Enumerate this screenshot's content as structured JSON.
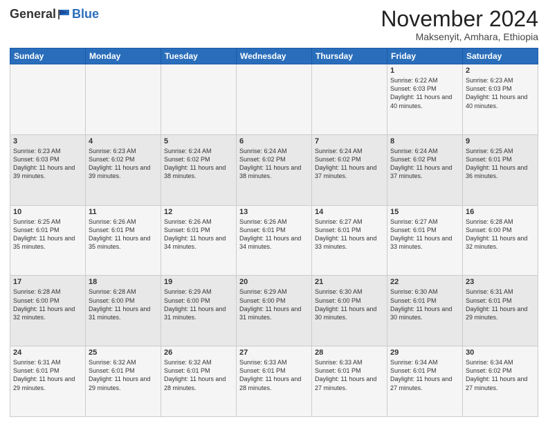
{
  "logo": {
    "general": "General",
    "blue": "Blue"
  },
  "header": {
    "month": "November 2024",
    "location": "Maksenyit, Amhara, Ethiopia"
  },
  "weekdays": [
    "Sunday",
    "Monday",
    "Tuesday",
    "Wednesday",
    "Thursday",
    "Friday",
    "Saturday"
  ],
  "weeks": [
    [
      {
        "day": "",
        "info": ""
      },
      {
        "day": "",
        "info": ""
      },
      {
        "day": "",
        "info": ""
      },
      {
        "day": "",
        "info": ""
      },
      {
        "day": "",
        "info": ""
      },
      {
        "day": "1",
        "info": "Sunrise: 6:22 AM\nSunset: 6:03 PM\nDaylight: 11 hours and 40 minutes."
      },
      {
        "day": "2",
        "info": "Sunrise: 6:23 AM\nSunset: 6:03 PM\nDaylight: 11 hours and 40 minutes."
      }
    ],
    [
      {
        "day": "3",
        "info": "Sunrise: 6:23 AM\nSunset: 6:03 PM\nDaylight: 11 hours and 39 minutes."
      },
      {
        "day": "4",
        "info": "Sunrise: 6:23 AM\nSunset: 6:02 PM\nDaylight: 11 hours and 39 minutes."
      },
      {
        "day": "5",
        "info": "Sunrise: 6:24 AM\nSunset: 6:02 PM\nDaylight: 11 hours and 38 minutes."
      },
      {
        "day": "6",
        "info": "Sunrise: 6:24 AM\nSunset: 6:02 PM\nDaylight: 11 hours and 38 minutes."
      },
      {
        "day": "7",
        "info": "Sunrise: 6:24 AM\nSunset: 6:02 PM\nDaylight: 11 hours and 37 minutes."
      },
      {
        "day": "8",
        "info": "Sunrise: 6:24 AM\nSunset: 6:02 PM\nDaylight: 11 hours and 37 minutes."
      },
      {
        "day": "9",
        "info": "Sunrise: 6:25 AM\nSunset: 6:01 PM\nDaylight: 11 hours and 36 minutes."
      }
    ],
    [
      {
        "day": "10",
        "info": "Sunrise: 6:25 AM\nSunset: 6:01 PM\nDaylight: 11 hours and 35 minutes."
      },
      {
        "day": "11",
        "info": "Sunrise: 6:26 AM\nSunset: 6:01 PM\nDaylight: 11 hours and 35 minutes."
      },
      {
        "day": "12",
        "info": "Sunrise: 6:26 AM\nSunset: 6:01 PM\nDaylight: 11 hours and 34 minutes."
      },
      {
        "day": "13",
        "info": "Sunrise: 6:26 AM\nSunset: 6:01 PM\nDaylight: 11 hours and 34 minutes."
      },
      {
        "day": "14",
        "info": "Sunrise: 6:27 AM\nSunset: 6:01 PM\nDaylight: 11 hours and 33 minutes."
      },
      {
        "day": "15",
        "info": "Sunrise: 6:27 AM\nSunset: 6:01 PM\nDaylight: 11 hours and 33 minutes."
      },
      {
        "day": "16",
        "info": "Sunrise: 6:28 AM\nSunset: 6:00 PM\nDaylight: 11 hours and 32 minutes."
      }
    ],
    [
      {
        "day": "17",
        "info": "Sunrise: 6:28 AM\nSunset: 6:00 PM\nDaylight: 11 hours and 32 minutes."
      },
      {
        "day": "18",
        "info": "Sunrise: 6:28 AM\nSunset: 6:00 PM\nDaylight: 11 hours and 31 minutes."
      },
      {
        "day": "19",
        "info": "Sunrise: 6:29 AM\nSunset: 6:00 PM\nDaylight: 11 hours and 31 minutes."
      },
      {
        "day": "20",
        "info": "Sunrise: 6:29 AM\nSunset: 6:00 PM\nDaylight: 11 hours and 31 minutes."
      },
      {
        "day": "21",
        "info": "Sunrise: 6:30 AM\nSunset: 6:00 PM\nDaylight: 11 hours and 30 minutes."
      },
      {
        "day": "22",
        "info": "Sunrise: 6:30 AM\nSunset: 6:01 PM\nDaylight: 11 hours and 30 minutes."
      },
      {
        "day": "23",
        "info": "Sunrise: 6:31 AM\nSunset: 6:01 PM\nDaylight: 11 hours and 29 minutes."
      }
    ],
    [
      {
        "day": "24",
        "info": "Sunrise: 6:31 AM\nSunset: 6:01 PM\nDaylight: 11 hours and 29 minutes."
      },
      {
        "day": "25",
        "info": "Sunrise: 6:32 AM\nSunset: 6:01 PM\nDaylight: 11 hours and 29 minutes."
      },
      {
        "day": "26",
        "info": "Sunrise: 6:32 AM\nSunset: 6:01 PM\nDaylight: 11 hours and 28 minutes."
      },
      {
        "day": "27",
        "info": "Sunrise: 6:33 AM\nSunset: 6:01 PM\nDaylight: 11 hours and 28 minutes."
      },
      {
        "day": "28",
        "info": "Sunrise: 6:33 AM\nSunset: 6:01 PM\nDaylight: 11 hours and 27 minutes."
      },
      {
        "day": "29",
        "info": "Sunrise: 6:34 AM\nSunset: 6:01 PM\nDaylight: 11 hours and 27 minutes."
      },
      {
        "day": "30",
        "info": "Sunrise: 6:34 AM\nSunset: 6:02 PM\nDaylight: 11 hours and 27 minutes."
      }
    ]
  ]
}
